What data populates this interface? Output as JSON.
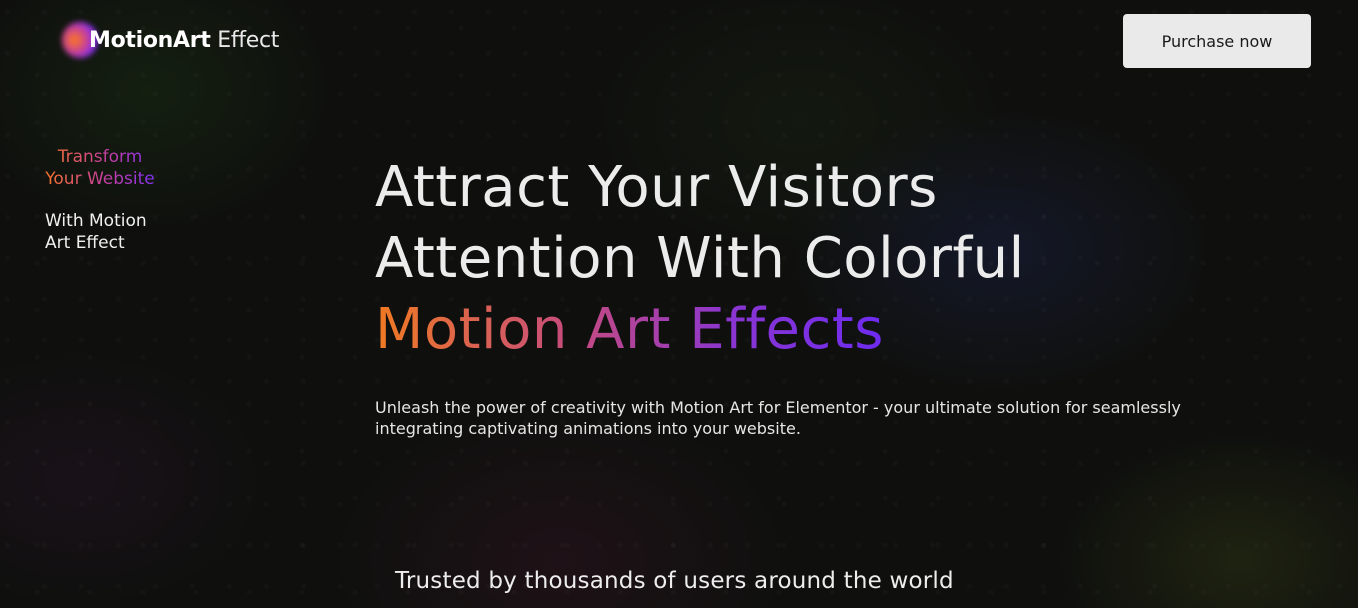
{
  "header": {
    "logo_bold": "MotionArt",
    "logo_light": " Effect",
    "purchase_label": "Purchase now"
  },
  "side": {
    "gradient_text": "Transform Your Website",
    "white_text": "With Motion Art Effect"
  },
  "hero": {
    "line1": "Attract Your Visitors",
    "line2": "Attention With Colorful",
    "line3": "Motion Art Effects",
    "description": "Unleash the power of creativity with Motion Art for Elementor - your ultimate solution for seamlessly integrating captivating animations into your website."
  },
  "trusted": {
    "text": "Trusted by thousands of users around the world"
  },
  "colors": {
    "gradient_start": "#f07a22",
    "gradient_mid": "#c44a82",
    "gradient_end": "#6e2bf0",
    "button_bg": "#eaeaea"
  }
}
